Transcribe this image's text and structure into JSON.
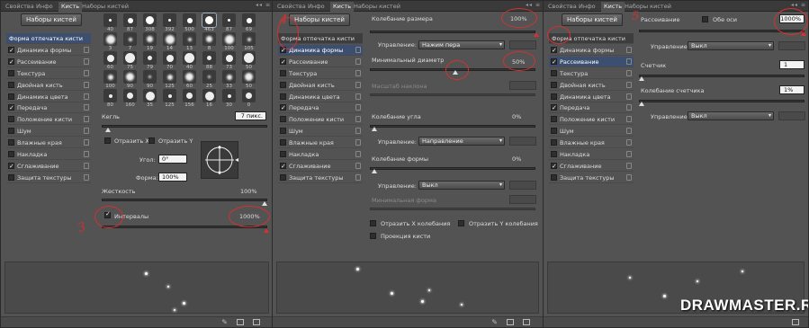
{
  "tabs": [
    "Свойства",
    "Инфо",
    "Кисть",
    "Наборы кистей"
  ],
  "tab_controls": "◂◂ ≡",
  "preset_button": "Наборы кистей",
  "options": [
    {
      "label": "Форма отпечатка кисти",
      "header": true
    },
    {
      "label": "Динамика формы",
      "checked": true
    },
    {
      "label": "Рассеивание",
      "checked": true
    },
    {
      "label": "Текстура",
      "checked": false
    },
    {
      "label": "Двойная кисть",
      "checked": false
    },
    {
      "label": "Динамика цвета",
      "checked": false
    },
    {
      "label": "Передача",
      "checked": true
    },
    {
      "label": "Положение кисти",
      "checked": false
    },
    {
      "label": "Шум",
      "checked": false
    },
    {
      "label": "Влажные края",
      "checked": false
    },
    {
      "label": "Накладка",
      "checked": false
    },
    {
      "label": "Сглаживание",
      "checked": true
    },
    {
      "label": "Защита текстуры",
      "checked": false
    }
  ],
  "panel1": {
    "tip_sizes": [
      [
        "40",
        "87",
        "308",
        "392",
        "500",
        "463",
        "87",
        "69"
      ],
      [
        "3",
        "7",
        "19",
        "14",
        "13",
        "8",
        "100",
        "105"
      ],
      [
        "60",
        "75",
        "79",
        "70",
        "40",
        "88",
        "73",
        "50"
      ],
      [
        "100",
        "90",
        "90",
        "125",
        "60",
        "25",
        "33",
        "50"
      ],
      [
        "80",
        "160",
        "35",
        "125",
        "156",
        "16",
        "30",
        "0"
      ]
    ],
    "size_label": "Кегль",
    "size_value": "7 пикс.",
    "flip_x": "Отразить X",
    "flip_y": "Отразить Y",
    "angle_label": "Угол:",
    "angle_value": "0°",
    "roundness_label": "Форма:",
    "roundness_value": "100%",
    "hardness_label": "Жесткость",
    "hardness_value": "100%",
    "spacing_label": "Интервалы",
    "spacing_value": "1000%",
    "step_number": "3"
  },
  "panel2": {
    "size_jitter_label": "Колебание размера",
    "size_jitter_value": "100%",
    "control_label": "Управление:",
    "control_value_1": "Нажим пера",
    "min_diameter_label": "Минимальный диаметр",
    "min_diameter_value": "50%",
    "tilt_scale_label": "Масштаб наклона",
    "angle_jitter_label": "Колебание угла",
    "angle_jitter_value": "0%",
    "control_value_2": "Направление",
    "roundness_jitter_label": "Колебание формы",
    "roundness_jitter_value": "0%",
    "control_value_3": "Выкл",
    "min_roundness_label": "Минимальная форма",
    "flip_x_jitter": "Отразить X колебания",
    "flip_y_jitter": "Отразить Y колебания",
    "brush_projection": "Проекция кисти",
    "step_number": "4"
  },
  "panel3": {
    "scatter_label": "Рассеивание",
    "both_axes": "Обе оси",
    "scatter_value": "1000%",
    "control_label": "Управление:",
    "control_value": "Выкл",
    "count_label": "Счетчик",
    "count_value": "1",
    "count_jitter_label": "Колебание счетчика",
    "count_jitter_value": "1%",
    "step_number": "5"
  },
  "watermark": "DRAWMASTER.RU",
  "colors": {
    "panel_bg": "#535353",
    "selected": "#3d4f70",
    "annotation": "#d63030"
  }
}
